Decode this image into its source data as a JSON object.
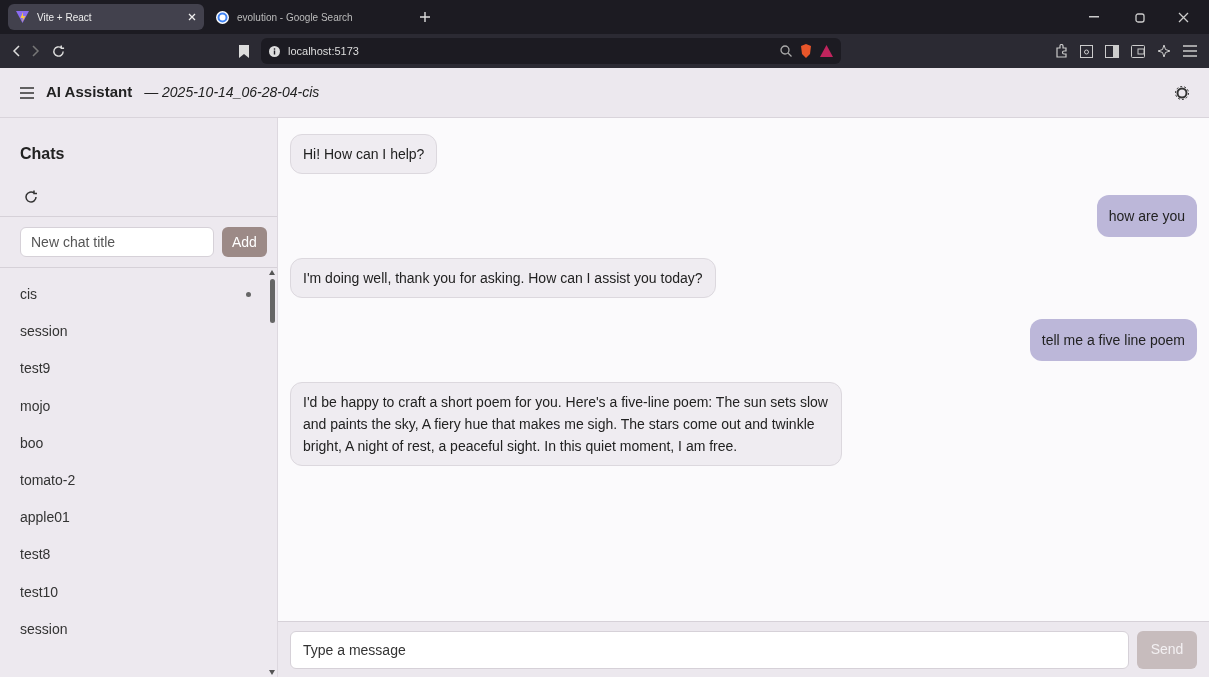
{
  "browser": {
    "tabs": [
      {
        "title": "Vite + React",
        "selected": true
      },
      {
        "title": "evolution - Google Search",
        "selected": false
      }
    ],
    "address": "localhost:5173"
  },
  "header": {
    "title": "AI Assistant",
    "subtitle": "— 2025-10-14_06-28-04-cis"
  },
  "sidebar": {
    "title": "Chats",
    "new_chat": {
      "placeholder": "New chat title",
      "button": "Add"
    },
    "items": [
      {
        "label": "cis",
        "selected": true
      },
      {
        "label": "session",
        "selected": false
      },
      {
        "label": "test9",
        "selected": false
      },
      {
        "label": "mojo",
        "selected": false
      },
      {
        "label": "boo",
        "selected": false
      },
      {
        "label": "tomato-2",
        "selected": false
      },
      {
        "label": "apple01",
        "selected": false
      },
      {
        "label": "test8",
        "selected": false
      },
      {
        "label": "test10",
        "selected": false
      },
      {
        "label": "session",
        "selected": false
      }
    ]
  },
  "messages": [
    {
      "kind": "assistant",
      "text": "Hi! How can I help?"
    },
    {
      "kind": "user",
      "text": "how are you"
    },
    {
      "kind": "assistant",
      "text": "I'm doing well, thank you for asking. How can I assist you today?"
    },
    {
      "kind": "user",
      "text": "tell me a five line poem"
    },
    {
      "kind": "assistant",
      "text": "I'd be happy to craft a short poem for you. Here's a five-line poem: The sun sets slow and paints the sky, A fiery hue that makes me sigh. The stars come out and twinkle bright, A night of rest, a peaceful sight. In this quiet moment, I am free."
    }
  ],
  "composer": {
    "placeholder": "Type a message",
    "button": "Send",
    "disabled": true
  }
}
